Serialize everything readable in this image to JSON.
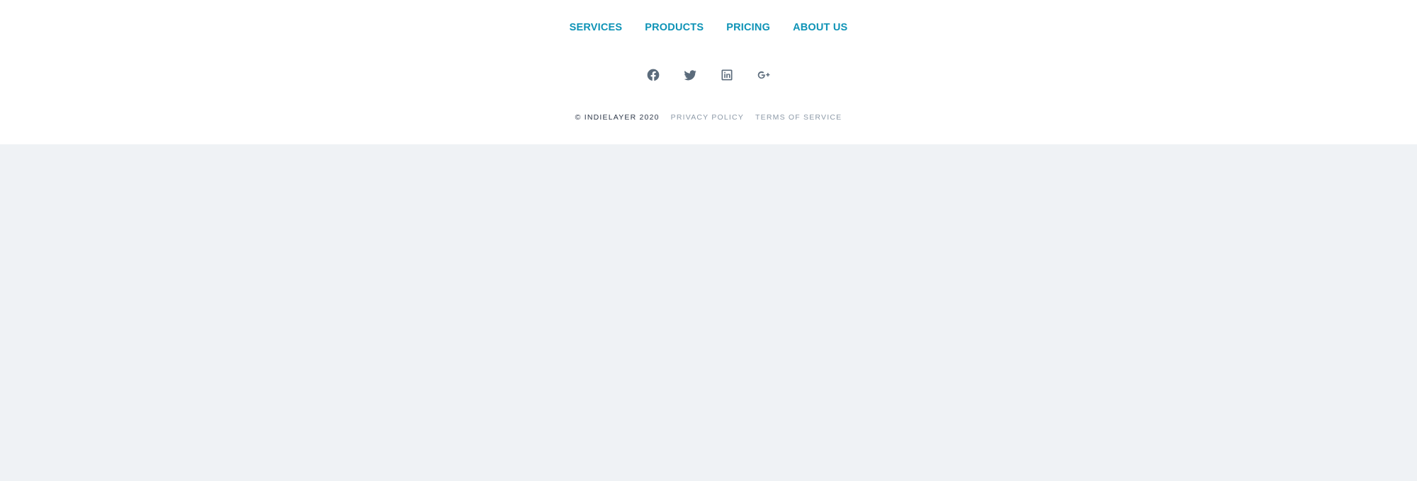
{
  "footer": {
    "nav": [
      {
        "label": "SERVICES"
      },
      {
        "label": "PRODUCTS"
      },
      {
        "label": "PRICING"
      },
      {
        "label": "ABOUT US"
      }
    ],
    "social": [
      {
        "icon": "facebook-icon"
      },
      {
        "icon": "twitter-icon"
      },
      {
        "icon": "linkedin-icon"
      },
      {
        "icon": "google-plus-icon"
      }
    ],
    "copyright": "© INDIELAYER 2020",
    "privacy_label": "PRIVACY POLICY",
    "terms_label": "TERMS OF SERVICE"
  },
  "colors": {
    "accent": "#0e93b6",
    "icon": "#5b6b7b",
    "footer_bg": "#ffffff",
    "page_bg": "#eff2f5"
  }
}
